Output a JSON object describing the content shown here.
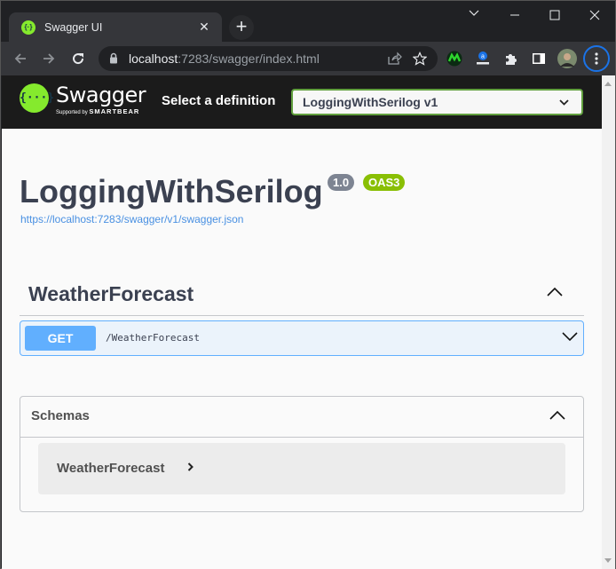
{
  "browser": {
    "tab_title": "Swagger UI",
    "url_host": "localhost",
    "url_path": ":7283/swagger/index.html",
    "extensions": [
      "monitor-extension-icon",
      "translate-extension-icon",
      "extensions-puzzle-icon",
      "side-panel-icon"
    ],
    "accent": "#1a73e8"
  },
  "header": {
    "logo_title": "Swagger",
    "logo_sub_prefix": "Supported by",
    "logo_sub_brand": "SMARTBEAR",
    "logo_mark": "{···}",
    "definition_label": "Select a definition",
    "definition_selected": "LoggingWithSerilog v1",
    "brand_color": "#85ea2d"
  },
  "info": {
    "title": "LoggingWithSerilog",
    "version": "1.0",
    "oas_badge": "OAS3",
    "spec_url": "https://localhost:7283/swagger/v1/swagger.json"
  },
  "tags": [
    {
      "name": "WeatherForecast",
      "expanded": true,
      "operations": [
        {
          "method": "GET",
          "path": "/WeatherForecast",
          "color": "#61affe"
        }
      ]
    }
  ],
  "schemas": {
    "title": "Schemas",
    "expanded": true,
    "items": [
      {
        "name": "WeatherForecast"
      }
    ]
  }
}
